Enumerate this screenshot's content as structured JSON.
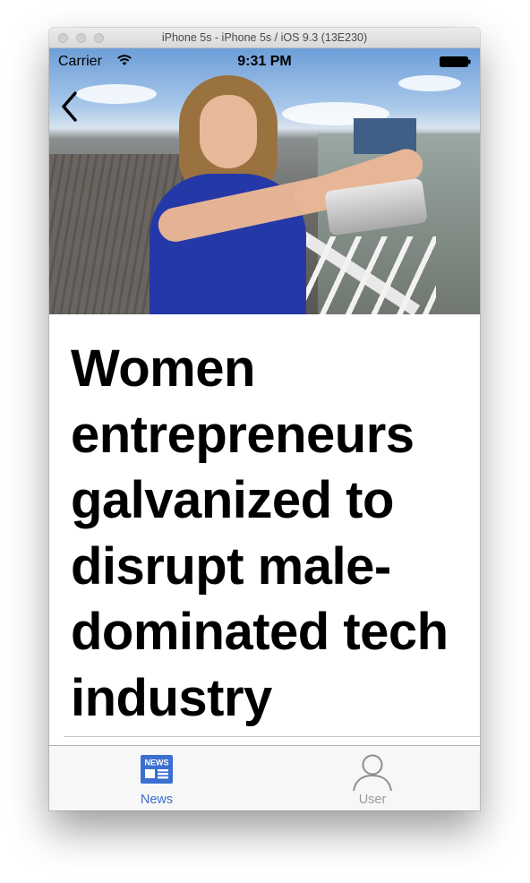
{
  "window": {
    "title": "iPhone 5s - iPhone 5s / iOS 9.3 (13E230)"
  },
  "statusbar": {
    "carrier": "Carrier",
    "time": "9:31 PM",
    "icons": [
      "wifi-icon",
      "battery-icon"
    ]
  },
  "navigation": {
    "back_icon": "chevron-left-icon"
  },
  "article": {
    "hero_image": "woman-taking-selfie-on-pier-photo",
    "headline": "Women entrepreneurs galvanized to disrupt male-dominated tech industry"
  },
  "tabbar": {
    "tabs": [
      {
        "label": "News",
        "icon": "news-icon",
        "icon_text": "NEWS",
        "selected": true
      },
      {
        "label": "User",
        "icon": "user-icon",
        "selected": false
      }
    ]
  },
  "colors": {
    "accent": "#3b6fd1",
    "tab_inactive": "#9a9a9a",
    "tabbar_background": "#f7f7f7"
  }
}
